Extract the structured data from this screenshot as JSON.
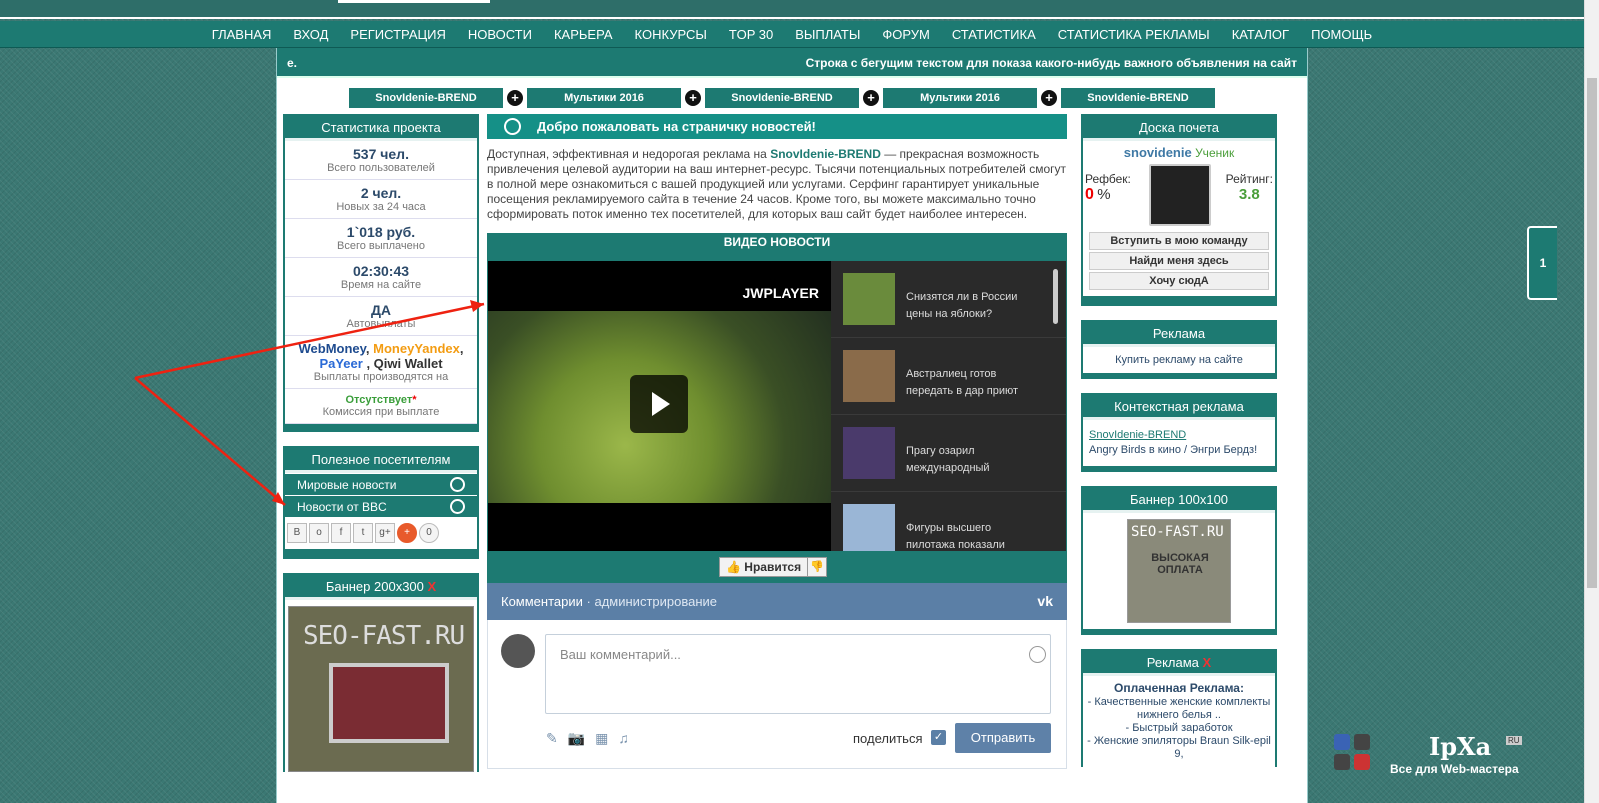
{
  "nav": [
    "Главная",
    "Вход",
    "Регистрация",
    "Новости",
    "Карьера",
    "Конкурсы",
    "TOP 30",
    "Выплаты",
    "Форум",
    "Статистика",
    "Статистика рекламы",
    "Каталог",
    "Помощь"
  ],
  "ticker": {
    "left": "е.",
    "right": "Строка с бегущим текстом для показа какого-нибудь важного объявления на сайт"
  },
  "tabs": [
    "SnovIdenie-BREND",
    "Мультики 2016",
    "SnovIdenie-BREND",
    "Мультики 2016",
    "SnovIdenie-BREND"
  ],
  "stats": {
    "title": "Статистика проекта",
    "items": [
      {
        "v": "537 чел.",
        "s": "Всего пользователей"
      },
      {
        "v": "2 чел.",
        "s": "Новых за 24 часа"
      },
      {
        "v": "1`018 руб.",
        "s": "Всего выплачено"
      },
      {
        "v": "02:30:43",
        "s": "Время на сайте"
      },
      {
        "v": "ДА",
        "s": "Автовыплаты"
      }
    ],
    "payments": {
      "a": "WebMoney",
      "b": "MoneyYandex",
      "c": "PaYeer",
      "d": "Qiwi Wallet",
      "s": "Выплаты производятся на"
    },
    "commission": {
      "v": "Отсутствует",
      "star": "*",
      "s": "Комиссия при выплате"
    }
  },
  "useful": {
    "title": "Полезное посетителям",
    "items": [
      "Мировые новости",
      "Новости от BBC"
    ],
    "share_count": "0"
  },
  "banner200": {
    "title": "Баннер 200x300",
    "x": "X",
    "brand": "SEO-FAST.RU"
  },
  "welcome": "Добро пожаловать на страничку новостей!",
  "intro": {
    "p1": "Доступная, эффективная и недорогая реклама на ",
    "brand": "SnovIdenie-BREND",
    "p2": " — прекрасная возможность привлечения целевой аудитории на ваш интернет-ресурс. Тысячи потенциальных потребителей смогут в полной мере ознакомиться с вашей продукцией или услугами. Серфинг гарантирует уникальные посещения рекламируемого сайта в течение 24 часов. Кроме того, вы можете максимально точно сформировать поток именно тех посетителей, для которых ваш сайт будет наиболее интересен."
  },
  "video": {
    "title": "ВИДЕО НОВОСТИ",
    "brand": "JWPLAYER",
    "playlist": [
      "Снизятся ли в России цены на яблоки?",
      "Австралиец готов передать в дар приют",
      "Прагу озарил международный",
      "Фигуры высшего пилотажа показали"
    ],
    "like": "Нравится"
  },
  "vk": {
    "comments": "Комментарии",
    "admin": "администрирование",
    "logo": "vk",
    "placeholder": "Ваш комментарий...",
    "share": "поделиться",
    "send": "Отправить"
  },
  "honor": {
    "title": "Доска почета",
    "name": "snovidenie",
    "rank": "Ученик",
    "refback_label": "Рефбек:",
    "refback": "0",
    "pct": "%",
    "rating_label": "Рейтинг:",
    "rating": "3.8",
    "buttons": [
      "Вступить в мою команду",
      "Найди меня здесь",
      "Хочу сюдА"
    ]
  },
  "ads": {
    "title": "Реклама",
    "link": "Купить рекламу на сайте"
  },
  "context": {
    "title": "Контекстная реклама",
    "link": "SnovIdenie-BREND",
    "text": "Angry Birds в кино / Энгри Бердз!"
  },
  "banner100": {
    "title": "Баннер 100x100",
    "brand": "SEO-FAST.RU",
    "line": "ВЫСОКАЯ ОПЛАТА"
  },
  "paid": {
    "title": "Реклама",
    "x": "X",
    "head": "Оплаченная Реклама:",
    "items": [
      "- Качественные женские комплекты нижнего белья ..",
      "- Быстрый заработок",
      "- Женские эпиляторы Braun Silk-epil 9,"
    ]
  },
  "side_tab": "1",
  "logo": {
    "name": "IpXa",
    "ru": "RU",
    "tag": "Все для Web-мастера"
  }
}
